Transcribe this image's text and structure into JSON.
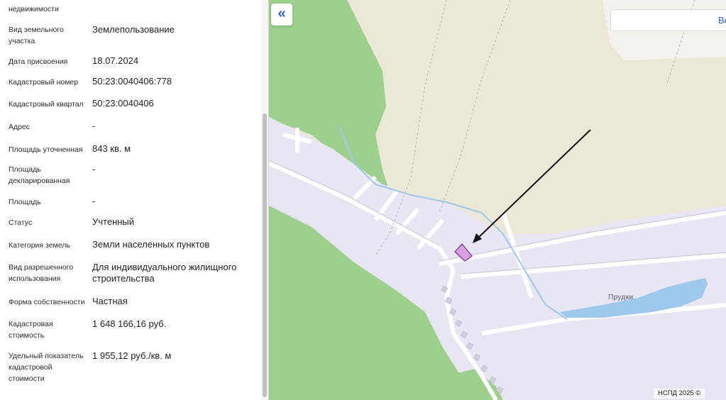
{
  "panel": {
    "rows": [
      {
        "label": "недвижимости",
        "value": ""
      },
      {
        "label": "Вид земельного участка",
        "value": "Землепользование"
      },
      {
        "label": "Дата присвоения",
        "value": "18.07.2024"
      },
      {
        "label": "Кадастровый номер",
        "value": "50:23:0040406:778"
      },
      {
        "label": "Кадастровый квартал",
        "value": "50:23:0040406"
      },
      {
        "label": "Адрес",
        "value": "-"
      },
      {
        "label": "Площадь уточненная",
        "value": "843 кв. м"
      },
      {
        "label": "Площадь декларированная",
        "value": "-"
      },
      {
        "label": "Площадь",
        "value": "-"
      },
      {
        "label": "Статус",
        "value": "Учтенный"
      },
      {
        "label": "Категория земель",
        "value": "Земли населенных пунктов"
      },
      {
        "label": "Вид разрешенного использования",
        "value": "Для индивидуального жилищного строительства"
      },
      {
        "label": "Форма собственности",
        "value": "Частная"
      },
      {
        "label": "Кадастровая стоимость",
        "value": "1 648 166,16 руб."
      },
      {
        "label": "Удельный показатель кадастровой стоимости",
        "value": "1 955,12 руб./кв. м"
      }
    ]
  },
  "map": {
    "collapse_icon": "«",
    "search_text": "Во",
    "place_label": "Прудки",
    "copyright": "НСПД 2025 ©",
    "colors": {
      "forest": "#9dcf8d",
      "settlement": "#e8e6f3",
      "field": "#ece8d8",
      "water": "#9ec8ec",
      "parcel_fill": "#d9a0e8",
      "parcel_stroke": "#7a2a8a",
      "accent": "#2c5bd6"
    }
  }
}
